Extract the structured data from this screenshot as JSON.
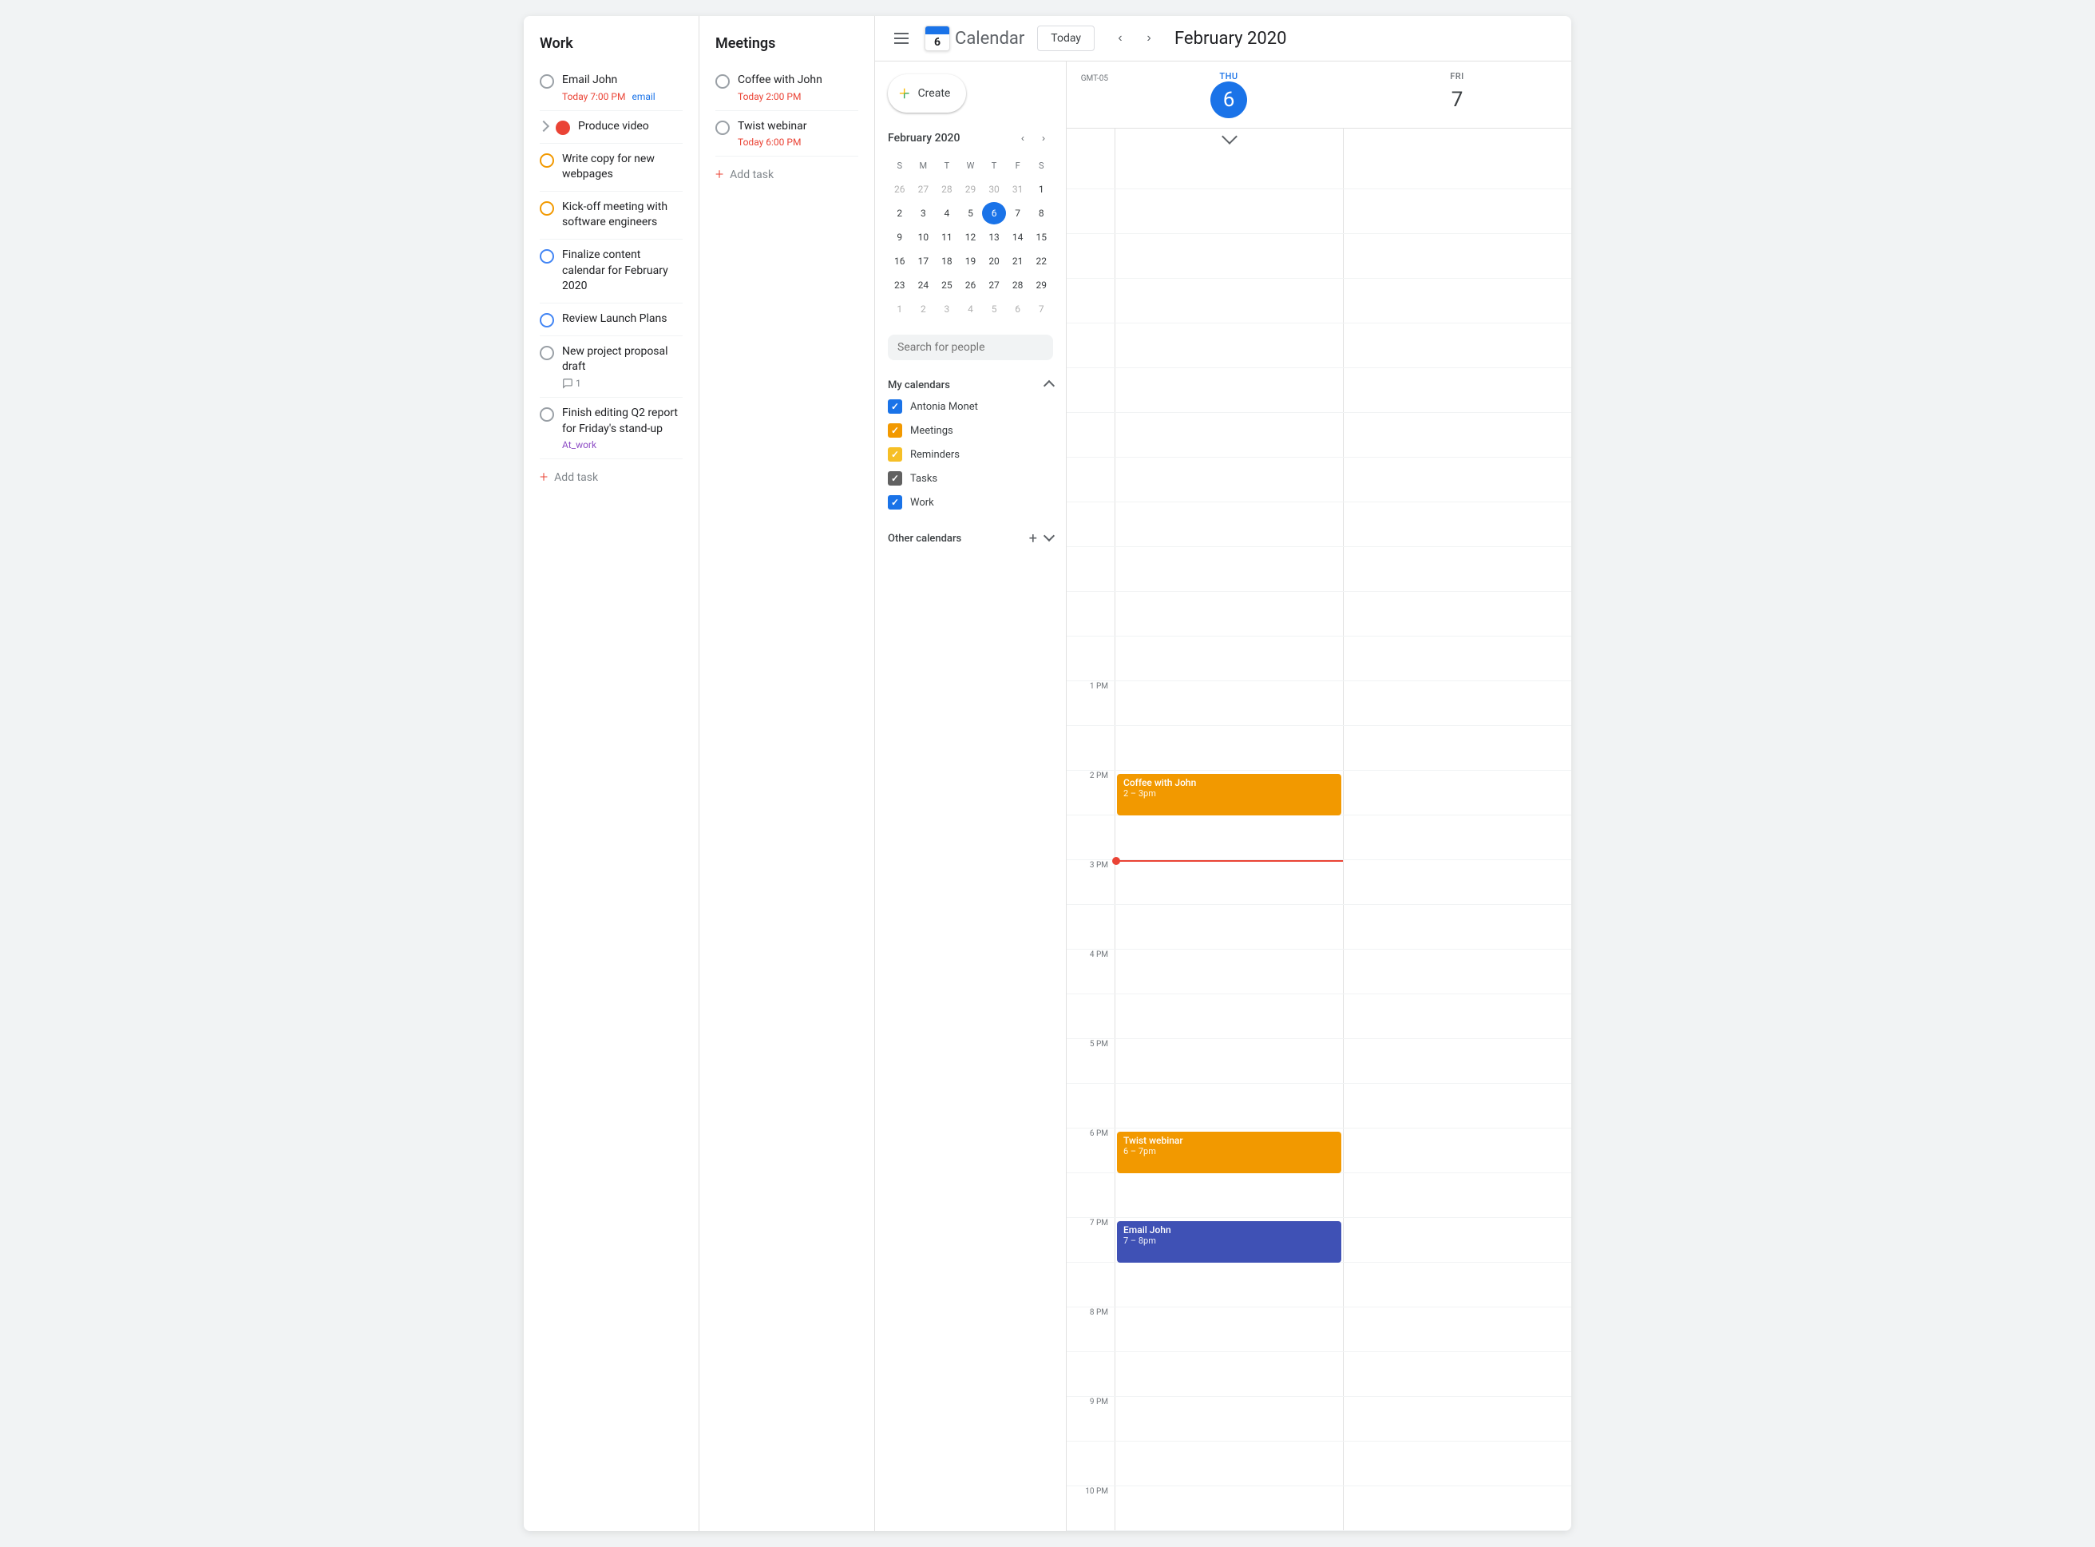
{
  "work": {
    "title": "Work",
    "tasks": [
      {
        "id": "email-john",
        "name": "Email John",
        "date": "Today 7:00 PM",
        "tag": "email",
        "checkbox_type": "default",
        "comments": null,
        "expandable": false
      },
      {
        "id": "produce-video",
        "name": "Produce video",
        "date": null,
        "tag": null,
        "checkbox_type": "red-circle",
        "comments": null,
        "expandable": true
      },
      {
        "id": "write-copy",
        "name": "Write copy for new webpages",
        "date": null,
        "tag": null,
        "checkbox_type": "orange",
        "comments": null,
        "expandable": false
      },
      {
        "id": "kickoff-meeting",
        "name": "Kick-off meeting with software engineers",
        "date": null,
        "tag": null,
        "checkbox_type": "orange",
        "comments": null,
        "expandable": false
      },
      {
        "id": "finalize-calendar",
        "name": "Finalize content calendar for February 2020",
        "date": null,
        "tag": null,
        "checkbox_type": "blue-outline",
        "comments": null,
        "expandable": false
      },
      {
        "id": "review-launch",
        "name": "Review Launch Plans",
        "date": null,
        "tag": null,
        "checkbox_type": "blue-outline2",
        "comments": null,
        "expandable": false
      },
      {
        "id": "new-project",
        "name": "New project proposal draft",
        "date": null,
        "tag": null,
        "checkbox_type": "default",
        "comments": "1",
        "expandable": false
      },
      {
        "id": "finish-editing",
        "name": "Finish editing Q2 report for Friday's stand-up",
        "date": null,
        "tag": "At_work",
        "checkbox_type": "default",
        "comments": null,
        "expandable": false
      }
    ],
    "add_task_label": "Add task"
  },
  "meetings": {
    "title": "Meetings",
    "tasks": [
      {
        "id": "coffee-john",
        "name": "Coffee with John",
        "date": "Today 2:00 PM",
        "checkbox_type": "default"
      },
      {
        "id": "twist-webinar",
        "name": "Twist webinar",
        "date": "Today 6:00 PM",
        "checkbox_type": "default"
      }
    ],
    "add_task_label": "Add task"
  },
  "calendar": {
    "app_title": "Calendar",
    "today_button": "Today",
    "month_year": "February 2020",
    "mini_calendar": {
      "title": "February 2020",
      "day_headers": [
        "S",
        "M",
        "T",
        "W",
        "T",
        "F",
        "S"
      ],
      "weeks": [
        [
          "26",
          "27",
          "28",
          "29",
          "30",
          "31",
          "1"
        ],
        [
          "2",
          "3",
          "4",
          "5",
          "6",
          "7",
          "8"
        ],
        [
          "9",
          "10",
          "11",
          "12",
          "13",
          "14",
          "15"
        ],
        [
          "16",
          "17",
          "18",
          "19",
          "20",
          "21",
          "22"
        ],
        [
          "23",
          "24",
          "25",
          "26",
          "27",
          "28",
          "29"
        ],
        [
          "1",
          "2",
          "3",
          "4",
          "5",
          "6",
          "7"
        ]
      ],
      "today_date": "6",
      "other_month_start": [
        "26",
        "27",
        "28",
        "29",
        "30",
        "31"
      ],
      "other_month_end": [
        "1",
        "2",
        "3",
        "4",
        "5",
        "6",
        "7"
      ]
    },
    "create_button": "Create",
    "search_people_placeholder": "Search for people",
    "my_calendars": {
      "title": "My calendars",
      "items": [
        {
          "name": "Antonia Monet",
          "color": "blue",
          "checked": true
        },
        {
          "name": "Meetings",
          "color": "orange",
          "checked": true
        },
        {
          "name": "Reminders",
          "color": "yellow",
          "checked": true
        },
        {
          "name": "Tasks",
          "color": "gray",
          "checked": true
        },
        {
          "name": "Work",
          "color": "dark-blue",
          "checked": true
        }
      ]
    },
    "other_calendars": {
      "title": "Other calendars"
    },
    "days": [
      {
        "name": "THU",
        "number": "6",
        "is_today": true
      },
      {
        "name": "FRI",
        "number": "7",
        "is_today": false
      }
    ],
    "time_slots": [
      {
        "label": ""
      },
      {
        "label": ""
      },
      {
        "label": ""
      },
      {
        "label": ""
      },
      {
        "label": ""
      },
      {
        "label": ""
      },
      {
        "label": ""
      },
      {
        "label": ""
      },
      {
        "label": ""
      },
      {
        "label": ""
      },
      {
        "label": ""
      },
      {
        "label": ""
      },
      {
        "label": "1 PM"
      },
      {
        "label": ""
      },
      {
        "label": "2 PM"
      },
      {
        "label": ""
      },
      {
        "label": "3 PM"
      },
      {
        "label": ""
      },
      {
        "label": "4 PM"
      },
      {
        "label": ""
      },
      {
        "label": "5 PM"
      },
      {
        "label": ""
      },
      {
        "label": "6 PM"
      },
      {
        "label": ""
      },
      {
        "label": "7 PM"
      },
      {
        "label": ""
      },
      {
        "label": "8 PM"
      },
      {
        "label": ""
      },
      {
        "label": "9 PM"
      },
      {
        "label": ""
      },
      {
        "label": "10 PM"
      }
    ],
    "events": {
      "thu": [
        {
          "id": "coffee-event",
          "title": "Coffee with John",
          "time": "2 – 3pm",
          "color": "orange",
          "slot_start": 14,
          "slot_end": 15
        },
        {
          "id": "twist-event",
          "title": "Twist webinar",
          "time": "6 – 7pm",
          "color": "orange",
          "slot_start": 18,
          "slot_end": 19
        },
        {
          "id": "email-event",
          "title": "Email John",
          "time": "7 – 8pm",
          "color": "blue",
          "slot_start": 19,
          "slot_end": 20
        }
      ]
    },
    "gmt_label": "GMT-05"
  }
}
